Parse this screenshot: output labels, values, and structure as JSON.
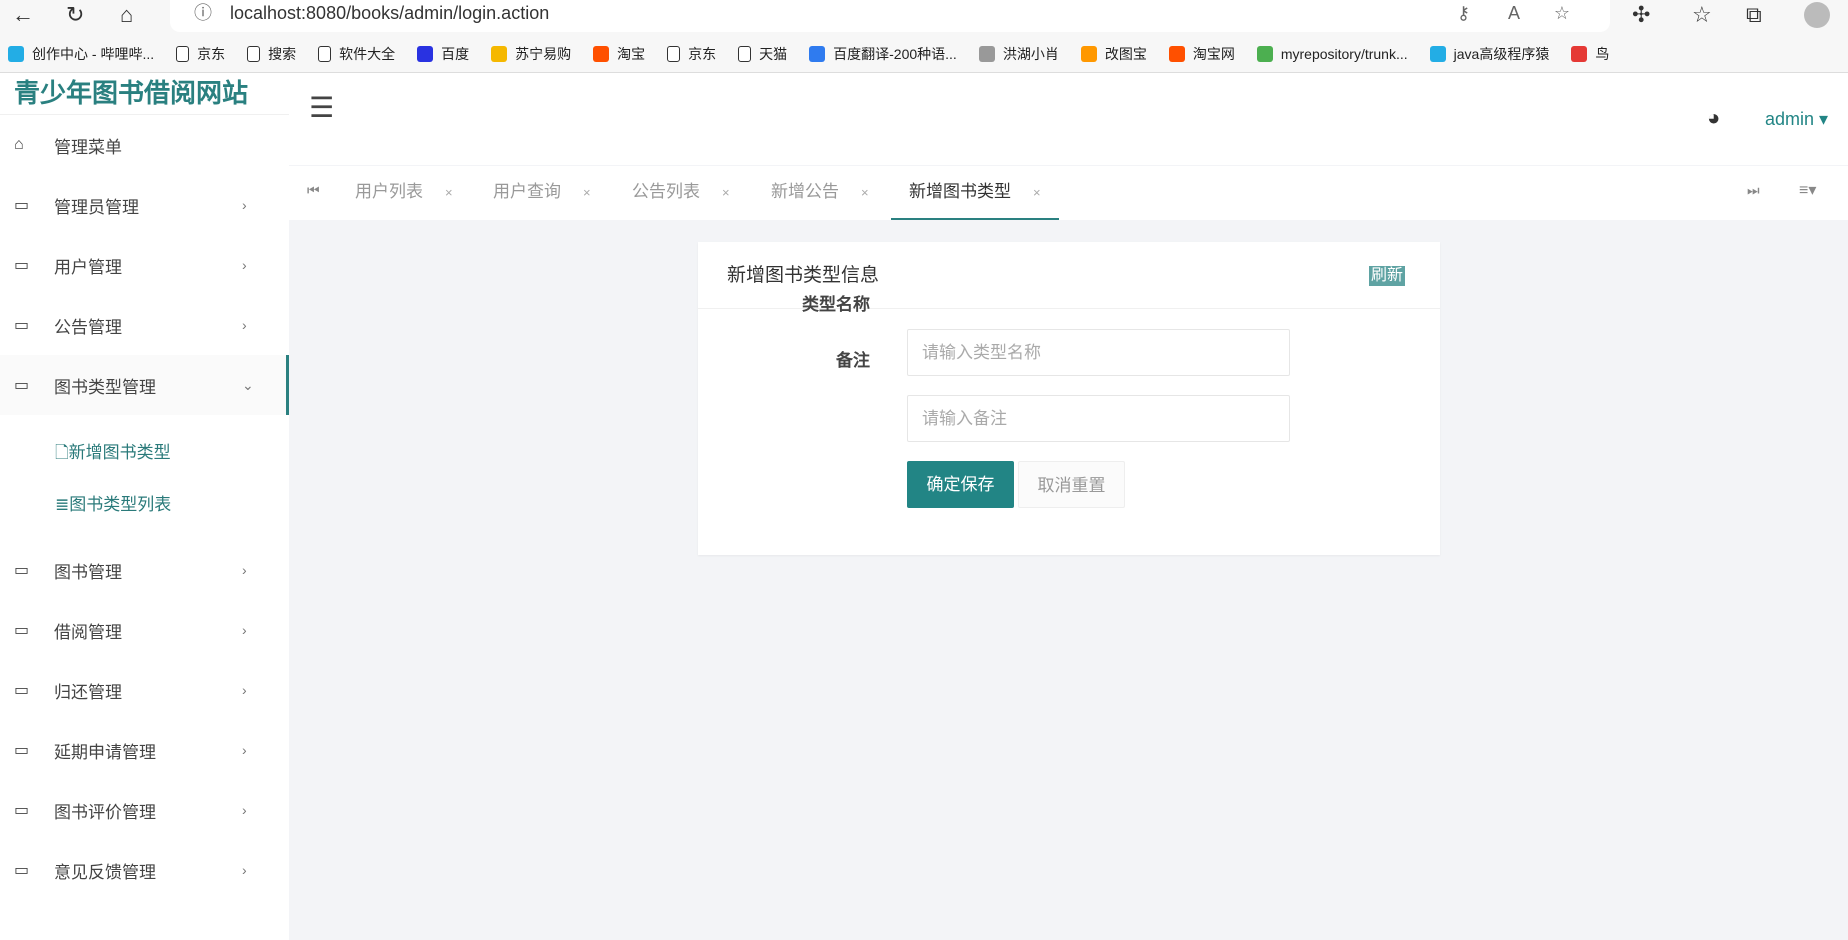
{
  "browser": {
    "url": "localhost:8080/books/admin/login.action",
    "bookmarks": [
      {
        "label": "创作中心 - 哔哩哔...",
        "color": "#23ade5"
      },
      {
        "label": "京东",
        "color": "#fff"
      },
      {
        "label": "搜索",
        "color": "#fff"
      },
      {
        "label": "软件大全",
        "color": "#fff"
      },
      {
        "label": "百度",
        "color": "#2932e1"
      },
      {
        "label": "苏宁易购",
        "color": "#f5b800"
      },
      {
        "label": "淘宝",
        "color": "#ff5000"
      },
      {
        "label": "京东",
        "color": "#fff"
      },
      {
        "label": "天猫",
        "color": "#fff"
      },
      {
        "label": "百度翻译-200种语...",
        "color": "#2f7bef"
      },
      {
        "label": "洪湖小肖",
        "color": "#999"
      },
      {
        "label": "改图宝",
        "color": "#ff9800"
      },
      {
        "label": "淘宝网",
        "color": "#ff5000"
      },
      {
        "label": "myrepository/trunk...",
        "color": "#4caf50"
      },
      {
        "label": "java高级程序猿",
        "color": "#23ade5"
      },
      {
        "label": "鸟",
        "color": "#e53935"
      }
    ]
  },
  "sidebar": {
    "logo": "青少年图书借阅网站",
    "menu_title": "管理菜单",
    "items": [
      "管理员管理",
      "用户管理",
      "公告管理",
      "图书类型管理",
      "图书管理",
      "借阅管理",
      "归还管理",
      "延期申请管理",
      "图书评价管理",
      "意见反馈管理"
    ],
    "sub": [
      "新增图书类型",
      "图书类型列表"
    ]
  },
  "header": {
    "user": "admin"
  },
  "tabs": [
    {
      "label": "用户列表"
    },
    {
      "label": "用户查询"
    },
    {
      "label": "公告列表"
    },
    {
      "label": "新增公告"
    },
    {
      "label": "新增图书类型"
    }
  ],
  "card": {
    "title": "新增图书类型信息",
    "refresh": "刷新",
    "fields": [
      {
        "label": "类型名称",
        "placeholder": "请输入类型名称",
        "value": ""
      },
      {
        "label": "备注",
        "placeholder": "请输入备注",
        "value": ""
      }
    ],
    "save": "确定保存",
    "reset": "取消重置"
  },
  "colors": {
    "accent": "#228585"
  }
}
